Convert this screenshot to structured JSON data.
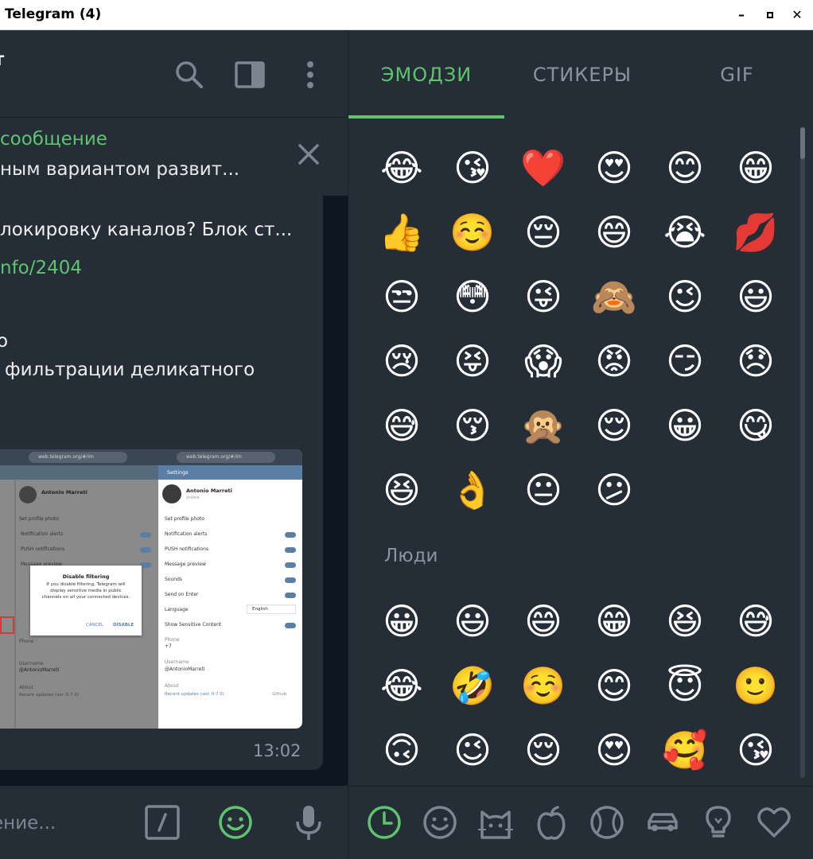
{
  "window": {
    "title": "Telegram (4)",
    "controls": {
      "minimize": "–",
      "maximize": "▫",
      "close": "✕"
    }
  },
  "chat": {
    "header_name": "т",
    "pinned": {
      "title": "сообщение",
      "text": "ным вариантом развит..."
    },
    "message": {
      "line1": "локировку каналов? Блок ст...",
      "link": "nfo/2404",
      "line3": "о",
      "line4": "фильтрации деликатного",
      "time": "13:02"
    },
    "composer_placeholder": "ение..."
  },
  "screenshot": {
    "url": "web.telegram.org/#/im",
    "settings_label": "Settings",
    "profile_name": "Antonio Marreti",
    "profile_status": "online",
    "rows": [
      "Set profile photo",
      "Notification alerts",
      "PUSH notifications",
      "Message preview",
      "Sounds",
      "Send on Enter",
      "Language",
      "Show Sensitive Content"
    ],
    "language_value": "English",
    "phone_label": "Phone",
    "phone_value": "+7",
    "username_label": "Username",
    "username_value": "@AntonioMarreti",
    "about_label": "About",
    "recent_updates": "Recent updates (ver. 0.7.0)",
    "github": "Github",
    "dialog": {
      "title": "Disable filtering",
      "body": "If you disable filtering, Telegram will display sensitive media in public channels on all your connected devices.",
      "cancel": "CANCEL",
      "disable": "DISABLE"
    }
  },
  "emoji_panel": {
    "tabs": [
      "ЭМОДЗИ",
      "СТИКЕРЫ",
      "GIF"
    ],
    "active_tab": 0,
    "recent": [
      "😂",
      "😘",
      "❤️",
      "😍",
      "😊",
      "😁",
      "👍",
      "☺️",
      "😔",
      "😄",
      "😭",
      "💋",
      "😒",
      "😳",
      "😜",
      "🙈",
      "😉",
      "😃",
      "😢",
      "😝",
      "😱",
      "😡",
      "😏",
      "😞",
      "😅",
      "😚",
      "🙊",
      "😌",
      "😀",
      "😋",
      "😆",
      "👌",
      "😐",
      "😕"
    ],
    "people_title": "Люди",
    "people": [
      "😀",
      "😃",
      "😄",
      "😁",
      "😆",
      "😅",
      "😂",
      "🤣",
      "☺️",
      "😊",
      "😇",
      "🙂",
      "🙃",
      "😉",
      "😌",
      "😍",
      "🥰",
      "😘"
    ],
    "categories": [
      "recent-icon",
      "smile-icon",
      "cat-icon",
      "apple-icon",
      "ball-icon",
      "car-icon",
      "bulb-icon",
      "heart-icon"
    ]
  },
  "colors": {
    "accent": "#5ec46e",
    "panel": "#252d37",
    "background": "#0e1621",
    "muted": "#8a949e"
  }
}
